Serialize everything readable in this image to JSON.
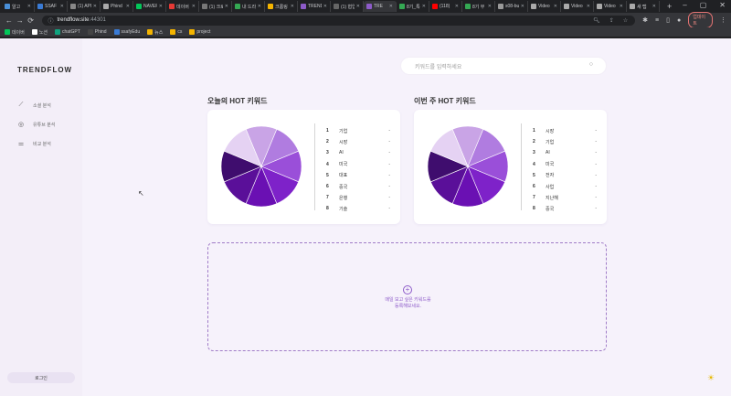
{
  "browser": {
    "tabs": [
      {
        "title": "알고",
        "color": "#4a90d9"
      },
      {
        "title": "SSAF",
        "color": "#3a7bd5"
      },
      {
        "title": "(1) API",
        "color": "#888888"
      },
      {
        "title": "Phind",
        "color": "#aaaaaa"
      },
      {
        "title": "NAVER",
        "color": "#03c75a"
      },
      {
        "title": "데이버",
        "color": "#e53935"
      },
      {
        "title": "(1) 크로",
        "color": "#777777"
      },
      {
        "title": "내 드라",
        "color": "#34a853"
      },
      {
        "title": "크롬링",
        "color": "#f4b400"
      },
      {
        "title": "TREND",
        "color": "#8d5bc9"
      },
      {
        "title": "(1) 협업",
        "color": "#666666"
      },
      {
        "title": "TRE",
        "color": "#8d5bc9",
        "active": true
      },
      {
        "title": "8기_특",
        "color": "#34a853"
      },
      {
        "title": "(118)",
        "color": "#ff0000"
      },
      {
        "title": "8기 부",
        "color": "#34a853"
      },
      {
        "title": "s08-bu",
        "color": "#999999"
      },
      {
        "title": "Video",
        "color": "#aaaaaa"
      },
      {
        "title": "Video",
        "color": "#aaaaaa"
      },
      {
        "title": "Video",
        "color": "#aaaaaa"
      },
      {
        "title": "새 탭",
        "color": "#aaaaaa"
      }
    ],
    "url_host": "trendflow.site",
    "url_port": ":44301",
    "profile_label": "업데이트",
    "bookmarks": [
      {
        "label": "데이버",
        "color": "#03c75a"
      },
      {
        "label": "노션",
        "color": "#ffffff"
      },
      {
        "label": "chatGPT",
        "color": "#10a37f"
      },
      {
        "label": "Phind",
        "color": "#444444"
      },
      {
        "label": "ssafyEdu",
        "color": "#3a7bd5"
      },
      {
        "label": "뉴스",
        "color": "#f4b400"
      },
      {
        "label": "cs",
        "color": "#f4b400"
      },
      {
        "label": "project",
        "color": "#f4b400"
      }
    ]
  },
  "app": {
    "logo": "TRENDFLOW",
    "nav": [
      {
        "label": "소셜 분석",
        "icon": "chart-line-icon"
      },
      {
        "label": "유튜브 분석",
        "icon": "play-circle-icon"
      },
      {
        "label": "비교 분석",
        "icon": "sliders-icon"
      }
    ],
    "login_label": "로그인",
    "search_placeholder": "키워드를 입력하세요",
    "today": {
      "title": "오늘의 HOT 키워드",
      "keywords": [
        "기업",
        "시장",
        "AI",
        "미국",
        "대표",
        "중국",
        "은행",
        "기술"
      ]
    },
    "week": {
      "title": "이번 주 HOT 키워드",
      "keywords": [
        "시장",
        "기업",
        "AI",
        "미국",
        "전자",
        "사업",
        "지난해",
        "중국"
      ]
    },
    "rank_value": "-",
    "add_message_line1": "매일 보고 싶은 키워드를",
    "add_message_line2": "등록해보세요.",
    "pie_colors": [
      "#e5d2f3",
      "#c9a4e6",
      "#b07ce0",
      "#9a4fd9",
      "#7e22c9",
      "#6a10b3",
      "#5a0f99",
      "#3f0d6e"
    ]
  }
}
